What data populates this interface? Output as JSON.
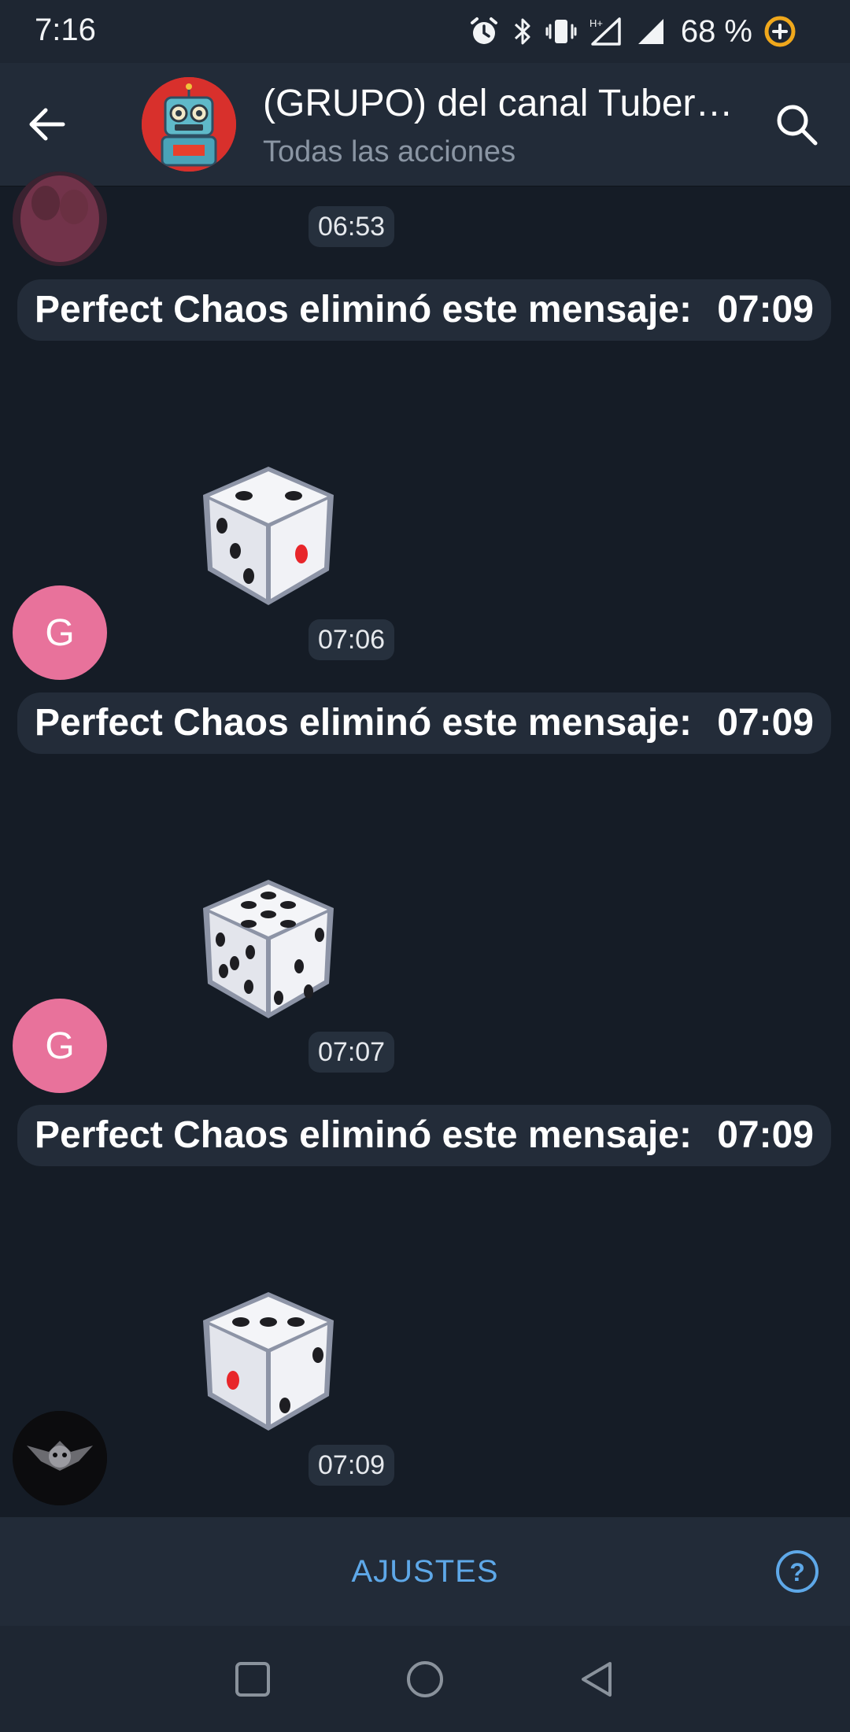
{
  "status_bar": {
    "time": "7:16",
    "network_label": "H+",
    "battery": "68 %",
    "icons": [
      "alarm-icon",
      "bluetooth-icon",
      "vibrate-icon",
      "signal-icon",
      "signal-icon",
      "battery-saver-icon"
    ]
  },
  "header": {
    "title": "(GRUPO) del canal Tuber…",
    "subtitle": "Todas las acciones",
    "back_icon": "back-arrow-icon",
    "search_icon": "search-icon"
  },
  "messages": [
    {
      "type": "dice",
      "avatar": "photo",
      "avatar_caption": "siempre feliz por siempre",
      "time": "06:53",
      "partial": true
    },
    {
      "type": "service",
      "text": "Perfect Chaos eliminó este mensaje:",
      "time": "07:09"
    },
    {
      "type": "dice",
      "avatar": "letter",
      "avatar_letter": "G",
      "time": "07:06",
      "dice_value": 5
    },
    {
      "type": "service",
      "text": "Perfect Chaos eliminó este mensaje:",
      "time": "07:09"
    },
    {
      "type": "dice",
      "avatar": "letter",
      "avatar_letter": "G",
      "time": "07:07",
      "dice_value": 6
    },
    {
      "type": "service",
      "text": "Perfect Chaos eliminó este mensaje:",
      "time": "07:09"
    },
    {
      "type": "dice",
      "avatar": "logo",
      "avatar_caption": "BossyBo$$$",
      "time": "07:09",
      "dice_value": 3
    }
  ],
  "bottom_bar": {
    "settings_label": "AJUSTES",
    "help_icon": "help-icon"
  },
  "nav_bar": {
    "buttons": [
      "recents-button",
      "home-button",
      "back-button"
    ]
  },
  "colors": {
    "background": "#151c26",
    "header": "#222b38",
    "accent": "#5ea8e8",
    "letter_avatar": "#e8729b"
  }
}
